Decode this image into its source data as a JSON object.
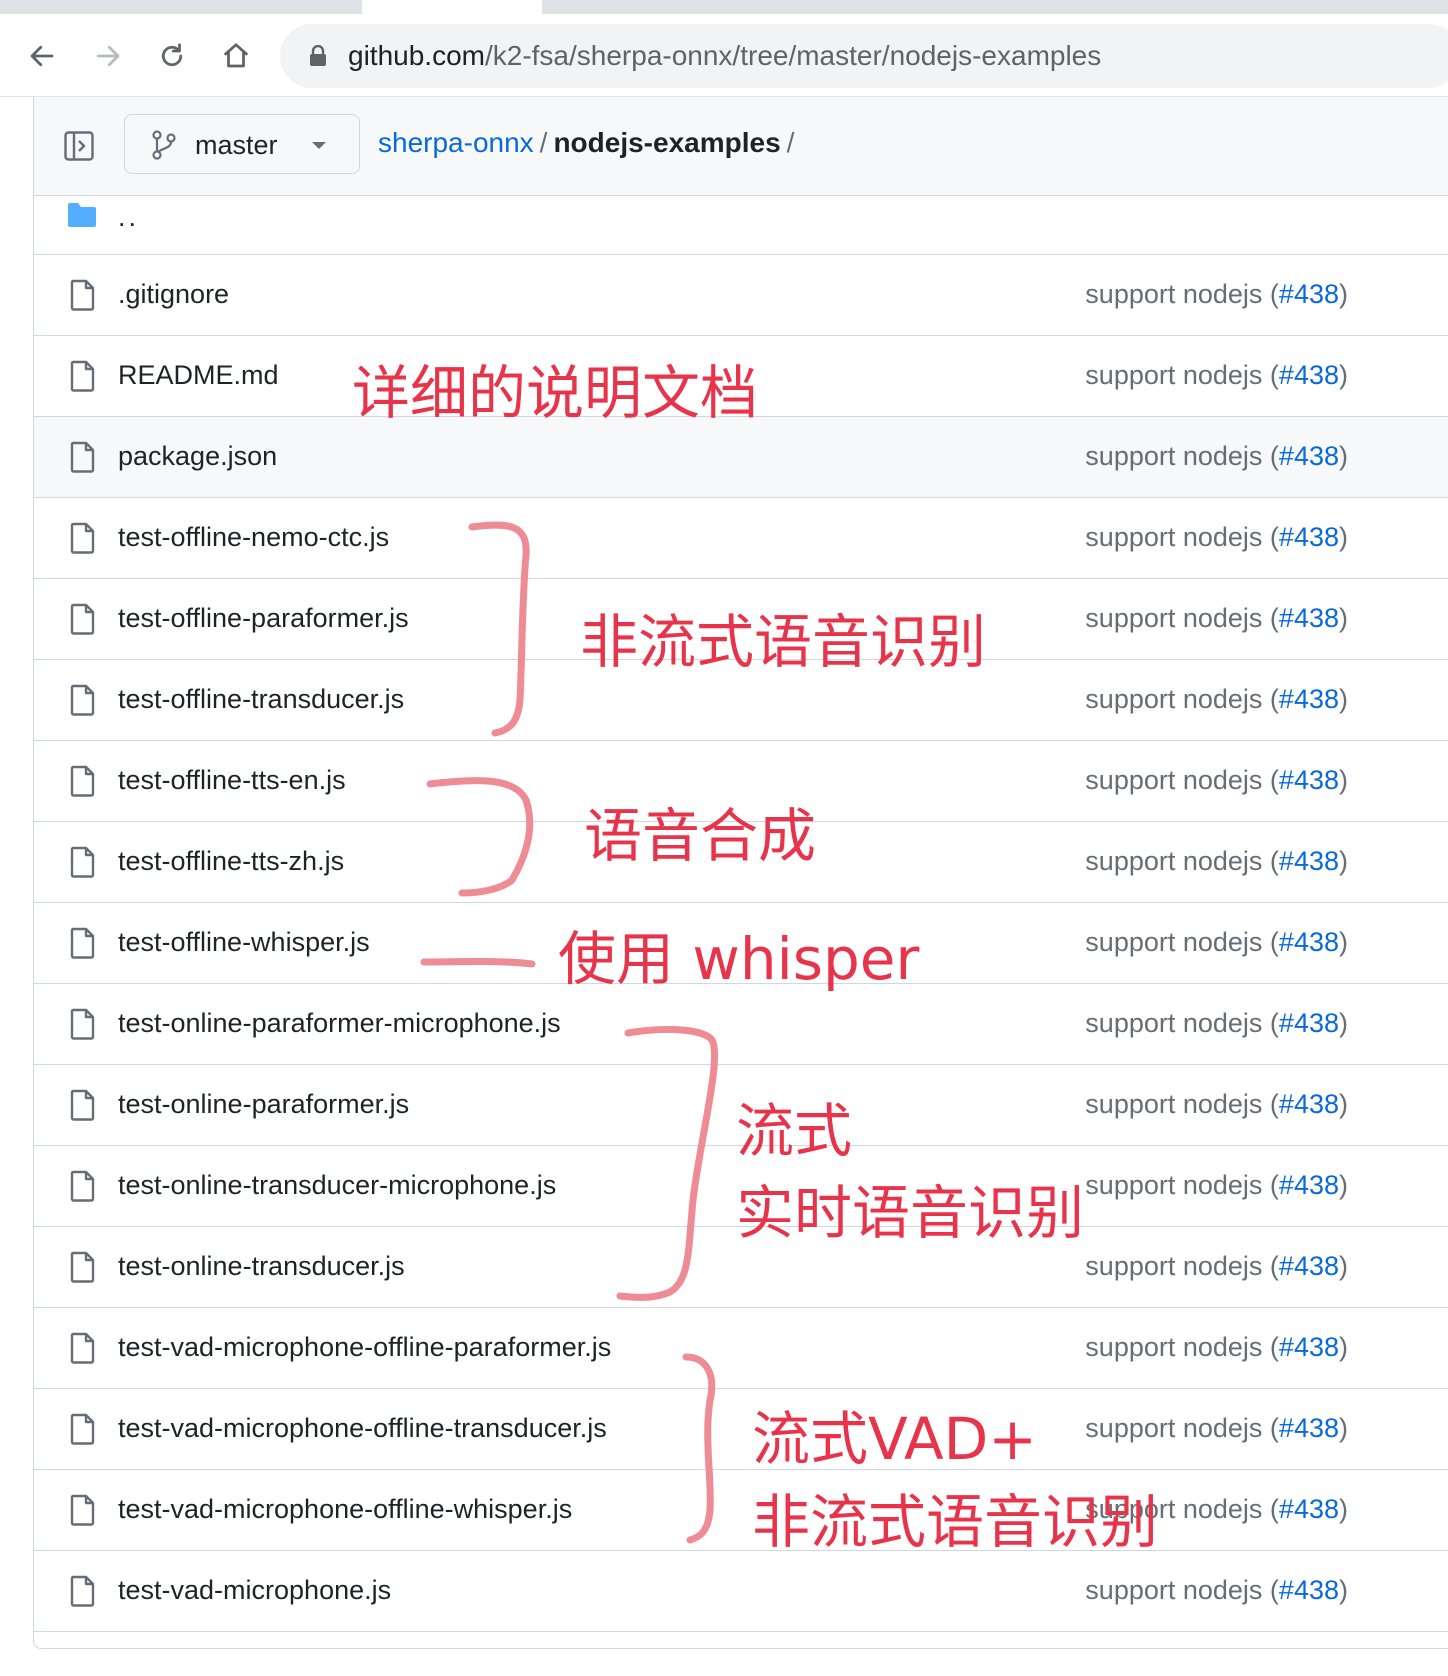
{
  "browser": {
    "url_host": "github.com",
    "url_path": "/k2-fsa/sherpa-onnx/tree/master/nodejs-examples"
  },
  "header": {
    "branch": "master",
    "breadcrumb": {
      "repo": "sherpa-onnx",
      "separator": "/",
      "dir": "nodejs-examples",
      "trailing": "/"
    }
  },
  "files": {
    "parent": "..",
    "rows": [
      {
        "name": ".gitignore",
        "commit": "support nodejs (",
        "pr": "#438",
        "close": ")"
      },
      {
        "name": "README.md",
        "commit": "support nodejs (",
        "pr": "#438",
        "close": ")"
      },
      {
        "name": "package.json",
        "commit": "support nodejs (",
        "pr": "#438",
        "close": ")"
      },
      {
        "name": "test-offline-nemo-ctc.js",
        "commit": "support nodejs (",
        "pr": "#438",
        "close": ")"
      },
      {
        "name": "test-offline-paraformer.js",
        "commit": "support nodejs (",
        "pr": "#438",
        "close": ")"
      },
      {
        "name": "test-offline-transducer.js",
        "commit": "support nodejs (",
        "pr": "#438",
        "close": ")"
      },
      {
        "name": "test-offline-tts-en.js",
        "commit": "support nodejs (",
        "pr": "#438",
        "close": ")"
      },
      {
        "name": "test-offline-tts-zh.js",
        "commit": "support nodejs (",
        "pr": "#438",
        "close": ")"
      },
      {
        "name": "test-offline-whisper.js",
        "commit": "support nodejs (",
        "pr": "#438",
        "close": ")"
      },
      {
        "name": "test-online-paraformer-microphone.js",
        "commit": "support nodejs (",
        "pr": "#438",
        "close": ")"
      },
      {
        "name": "test-online-paraformer.js",
        "commit": "support nodejs (",
        "pr": "#438",
        "close": ")"
      },
      {
        "name": "test-online-transducer-microphone.js",
        "commit": "support nodejs (",
        "pr": "#438",
        "close": ")"
      },
      {
        "name": "test-online-transducer.js",
        "commit": "support nodejs (",
        "pr": "#438",
        "close": ")"
      },
      {
        "name": "test-vad-microphone-offline-paraformer.js",
        "commit": "support nodejs (",
        "pr": "#438",
        "close": ")"
      },
      {
        "name": "test-vad-microphone-offline-transducer.js",
        "commit": "support nodejs (",
        "pr": "#438",
        "close": ")"
      },
      {
        "name": "test-vad-microphone-offline-whisper.js",
        "commit": "support nodejs (",
        "pr": "#438",
        "close": ")"
      },
      {
        "name": "test-vad-microphone.js",
        "commit": "support nodejs (",
        "pr": "#438",
        "close": ")"
      }
    ]
  },
  "annotations": {
    "readme": "详细的说明文档",
    "offline_asr": "非流式语音识别",
    "tts": "语音合成",
    "whisper": "使用 whisper",
    "online_line1": "流式",
    "online_line2": "实时语音识别",
    "vad_line1": "流式VAD+",
    "vad_line2": "非流式语音识别",
    "color": "#e8344a"
  }
}
